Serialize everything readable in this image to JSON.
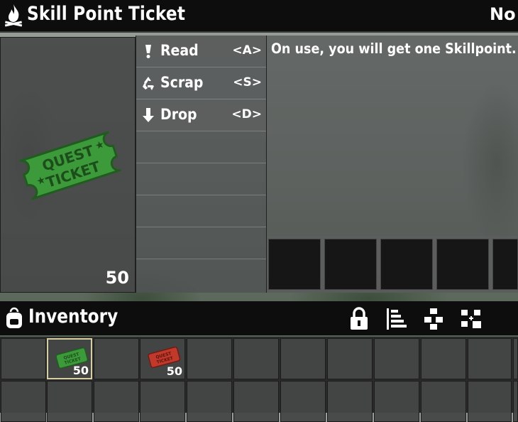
{
  "header": {
    "title": "Skill Point Ticket",
    "right_text": "No S"
  },
  "preview": {
    "count": "50",
    "item_icon": "quest-ticket-green"
  },
  "actions": [
    {
      "label": "Read",
      "key": "<A>",
      "icon": "exclamation-icon"
    },
    {
      "label": "Scrap",
      "key": "<S>",
      "icon": "recycle-icon"
    },
    {
      "label": "Drop",
      "key": "<D>",
      "icon": "arrow-down-icon"
    }
  ],
  "description": {
    "text": "On use, you will get one Skillpoint."
  },
  "inventory": {
    "title": "Inventory",
    "buttons": [
      "lock-icon",
      "sort-icon",
      "stack-icon",
      "move-icon"
    ],
    "items": [
      {
        "slot": 1,
        "icon": "quest-ticket-green",
        "count": "50",
        "selected": true
      },
      {
        "slot": 3,
        "icon": "quest-ticket-red",
        "count": "50",
        "selected": false
      }
    ]
  },
  "colors": {
    "ticket_green": "#3c9a3a",
    "ticket_red": "#c0392b",
    "header_bg": "#0d0d0d",
    "selected_border": "#d8cfa0"
  }
}
